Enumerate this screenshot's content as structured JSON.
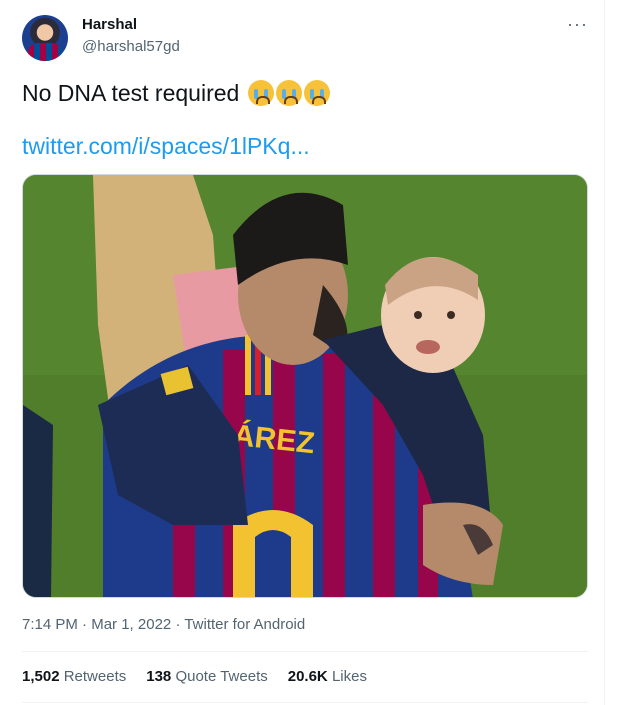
{
  "author": {
    "name": "Harshal",
    "handle": "@harshal57gd"
  },
  "tweet": {
    "text": "No DNA test required",
    "emoji_name": "loudly-crying-face",
    "emoji_count": 3,
    "link_text": "twitter.com/i/spaces/1lPKq...",
    "jersey_text": "ÁREZ"
  },
  "meta": {
    "time": "7:14 PM",
    "separator": "·",
    "date": "Mar 1, 2022",
    "source": "Twitter for Android"
  },
  "stats": {
    "retweets_count": "1,502",
    "retweets_label": "Retweets",
    "quotes_count": "138",
    "quotes_label": "Quote Tweets",
    "likes_count": "20.6K",
    "likes_label": "Likes"
  },
  "icons": {
    "more": "more-horizontal-icon"
  },
  "colors": {
    "link": "#1d9bf0",
    "secondary_text": "#536471",
    "primary_text": "#0f1419"
  }
}
